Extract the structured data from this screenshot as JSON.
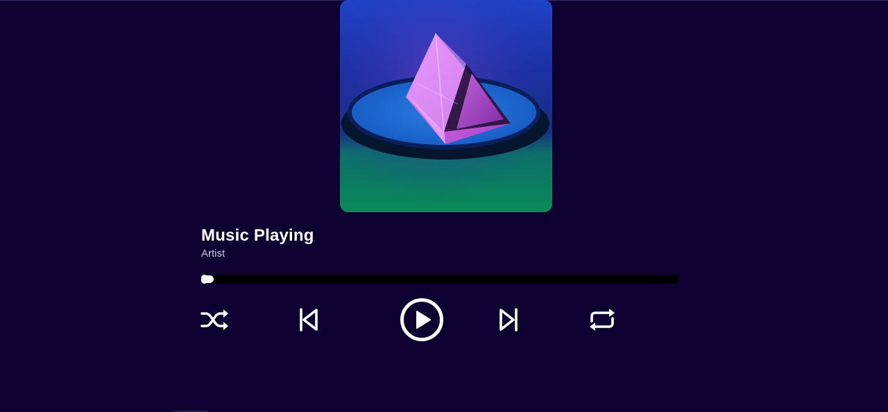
{
  "player": {
    "track_title": "Music Playing",
    "artist": "Artist",
    "progress_fraction": 0.013,
    "controls": {
      "shuffle": "shuffle-icon",
      "previous": "skip-previous-icon",
      "play": "play-circle-icon",
      "next": "skip-next-icon",
      "repeat": "repeat-icon"
    },
    "colors": {
      "background": "#0e0030",
      "progress_track": "#000000",
      "accent": "#ffffff"
    }
  }
}
